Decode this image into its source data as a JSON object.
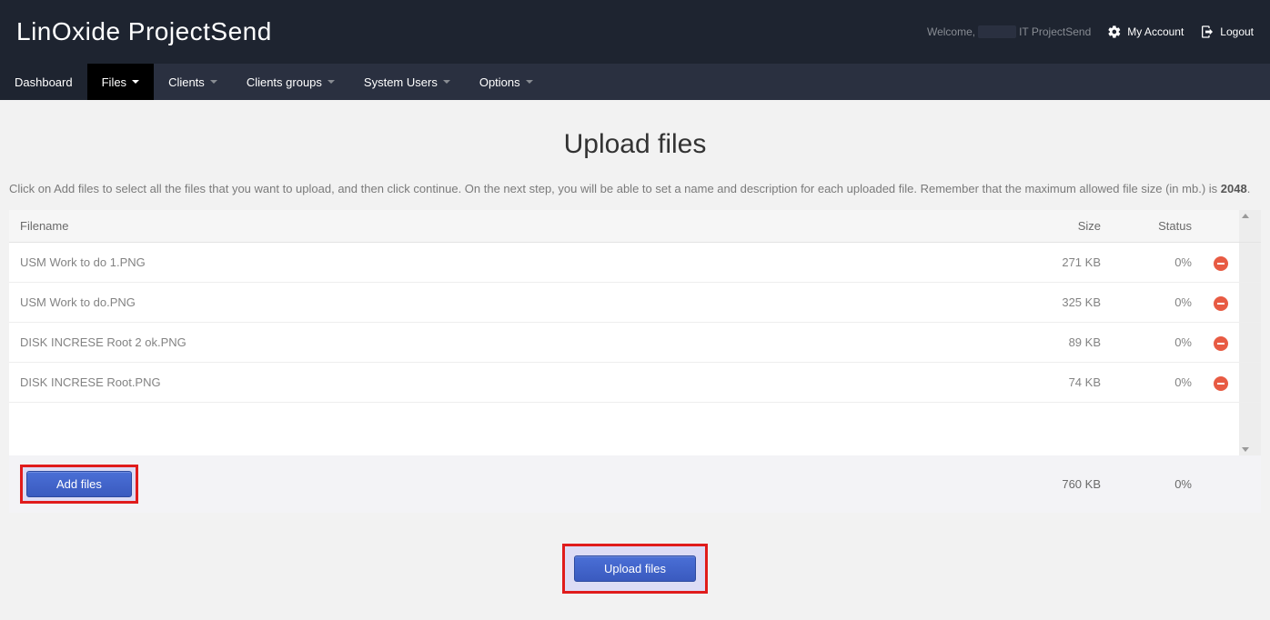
{
  "brand": "LinOxide ProjectSend",
  "header": {
    "welcome_prefix": "Welcome, ",
    "welcome_suffix": " IT ProjectSend",
    "my_account": "My Account",
    "logout": "Logout"
  },
  "nav": {
    "dashboard": "Dashboard",
    "files": "Files",
    "clients": "Clients",
    "clients_groups": "Clients groups",
    "system_users": "System Users",
    "options": "Options"
  },
  "page": {
    "title": "Upload files",
    "instruction_text": "Click on Add files to select all the files that you want to upload, and then click continue. On the next step, you will be able to set a name and description for each uploaded file. Remember that the maximum allowed file size (in mb.) is ",
    "max_size": "2048",
    "instruction_end": "."
  },
  "table": {
    "columns": {
      "filename": "Filename",
      "size": "Size",
      "status": "Status"
    },
    "rows": [
      {
        "filename": "USM Work to do 1.PNG",
        "size": "271 KB",
        "status": "0%"
      },
      {
        "filename": "USM Work to do.PNG",
        "size": "325 KB",
        "status": "0%"
      },
      {
        "filename": "DISK INCRESE Root 2 ok.PNG",
        "size": "89 KB",
        "status": "0%"
      },
      {
        "filename": "DISK INCRESE Root.PNG",
        "size": "74 KB",
        "status": "0%"
      }
    ],
    "footer": {
      "total_size": "760 KB",
      "total_status": "0%"
    }
  },
  "buttons": {
    "add_files": "Add files",
    "upload_files": "Upload files"
  }
}
